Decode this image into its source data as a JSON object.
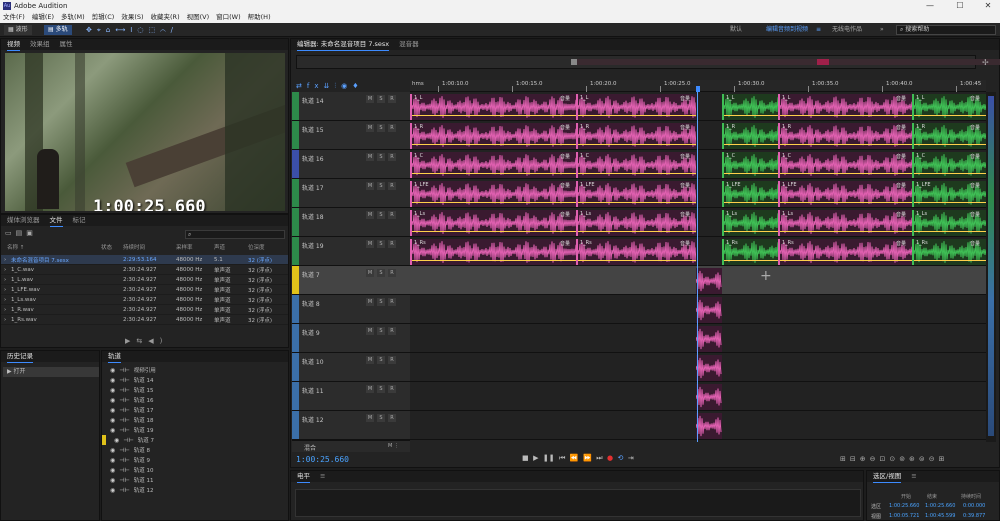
{
  "app": {
    "title": "Adobe Audition",
    "logo": "Au"
  },
  "window_controls": {
    "minimize": "—",
    "maximize": "☐",
    "close": "✕"
  },
  "menu": [
    "文件(F)",
    "编辑(E)",
    "多轨(M)",
    "剪辑(C)",
    "效果(S)",
    "收藏夹(R)",
    "视图(V)",
    "窗口(W)",
    "帮助(H)"
  ],
  "toolbar": {
    "waveform": "波形",
    "multitrack": "多轨"
  },
  "workspace": {
    "default": "默认",
    "editing": "编辑音频到视频",
    "radio": "无线电作品",
    "more": "»",
    "search": "搜索帮助"
  },
  "left_top_tabs": [
    "视频",
    "效果组",
    "属性"
  ],
  "video": {
    "timecode": "1:00:25.660"
  },
  "files_tabs": [
    "媒体浏览器",
    "文件",
    "标记"
  ],
  "files_headers": [
    "名称 ↑",
    "状态",
    "持续时间",
    "采样率",
    "声道",
    "位深度"
  ],
  "files": [
    {
      "name": "未命名混音项目 7.sesx",
      "status": "",
      "duration": "2:29:53.164",
      "rate": "48000 Hz",
      "channels": "5.1",
      "depth": "32 (浮点)"
    },
    {
      "name": "1_C.wav",
      "status": "",
      "duration": "2:30:24.927",
      "rate": "48000 Hz",
      "channels": "单声道",
      "depth": "32 (浮点)"
    },
    {
      "name": "1_L.wav",
      "status": "",
      "duration": "2:30:24.927",
      "rate": "48000 Hz",
      "channels": "单声道",
      "depth": "32 (浮点)"
    },
    {
      "name": "1_LFE.wav",
      "status": "",
      "duration": "2:30:24.927",
      "rate": "48000 Hz",
      "channels": "单声道",
      "depth": "32 (浮点)"
    },
    {
      "name": "1_Ls.wav",
      "status": "",
      "duration": "2:30:24.927",
      "rate": "48000 Hz",
      "channels": "单声道",
      "depth": "32 (浮点)"
    },
    {
      "name": "1_R.wav",
      "status": "",
      "duration": "2:30:24.927",
      "rate": "48000 Hz",
      "channels": "单声道",
      "depth": "32 (浮点)"
    },
    {
      "name": "1_Rs.wav",
      "status": "",
      "duration": "2:30:24.927",
      "rate": "48000 Hz",
      "channels": "单声道",
      "depth": "32 (浮点)"
    }
  ],
  "history": {
    "title": "历史记录",
    "item": "打开"
  },
  "tracks_panel": {
    "title": "轨道",
    "items": [
      "视频引用",
      "轨道 14",
      "轨道 15",
      "轨道 16",
      "轨道 17",
      "轨道 18",
      "轨道 19",
      "轨道 7",
      "轨道 8",
      "轨道 9",
      "轨道 10",
      "轨道 11",
      "轨道 12"
    ]
  },
  "editor": {
    "tab": "编辑器: 未命名混音项目 7.sesx",
    "mixer": "混音器"
  },
  "ruler": {
    "start": "hms",
    "labels": [
      "1:00:10.0",
      "1:00:15.0",
      "1:00:20.0",
      "1:00:25.0",
      "1:00:30.0",
      "1:00:35.0",
      "1:00:40.0",
      "1:00:45"
    ]
  },
  "tracks": [
    {
      "name": "轨道 14",
      "clip": "1_L",
      "color": "#2d8a4a"
    },
    {
      "name": "轨道 15",
      "clip": "1_R",
      "color": "#2d8a4a"
    },
    {
      "name": "轨道 16",
      "clip": "1_C",
      "color": "#3b4fa8"
    },
    {
      "name": "轨道 17",
      "clip": "1_LFE",
      "color": "#2d8a4a"
    },
    {
      "name": "轨道 18",
      "clip": "1_Ls",
      "color": "#2d8a4a"
    },
    {
      "name": "轨道 19",
      "clip": "1_Rs",
      "color": "#2d8a4a"
    },
    {
      "name": "轨道 7",
      "clip": "",
      "color": "#e0c21a"
    },
    {
      "name": "轨道 8",
      "clip": "",
      "color": "#3b6fa8"
    },
    {
      "name": "轨道 9",
      "clip": "",
      "color": "#3b6fa8"
    },
    {
      "name": "轨道 10",
      "clip": "",
      "color": "#3b6fa8"
    },
    {
      "name": "轨道 11",
      "clip": "",
      "color": "#3b6fa8"
    },
    {
      "name": "轨道 12",
      "clip": "",
      "color": "#3b6fa8"
    }
  ],
  "mix_track": "混合",
  "vol_label": "音量",
  "msr": [
    "M",
    "S",
    "R"
  ],
  "playhead_time": "1:00:25.660",
  "meter_panel": "电平",
  "selection_panel": {
    "title": "选区/视图",
    "headers": [
      "开始",
      "结束",
      "持续时间"
    ],
    "rows": [
      {
        "label": "选区",
        "start": "1:00:25.660",
        "end": "1:00:25.660",
        "dur": "0:00.000"
      },
      {
        "label": "视图",
        "start": "1:00:05.721",
        "end": "1:00:45.599",
        "dur": "0:39.877"
      }
    ]
  },
  "colors": {
    "clip_pink": "#e060b0",
    "clip_green": "#3fbf55",
    "accent": "#3d8bff",
    "timecode": "#4aa3ff"
  }
}
